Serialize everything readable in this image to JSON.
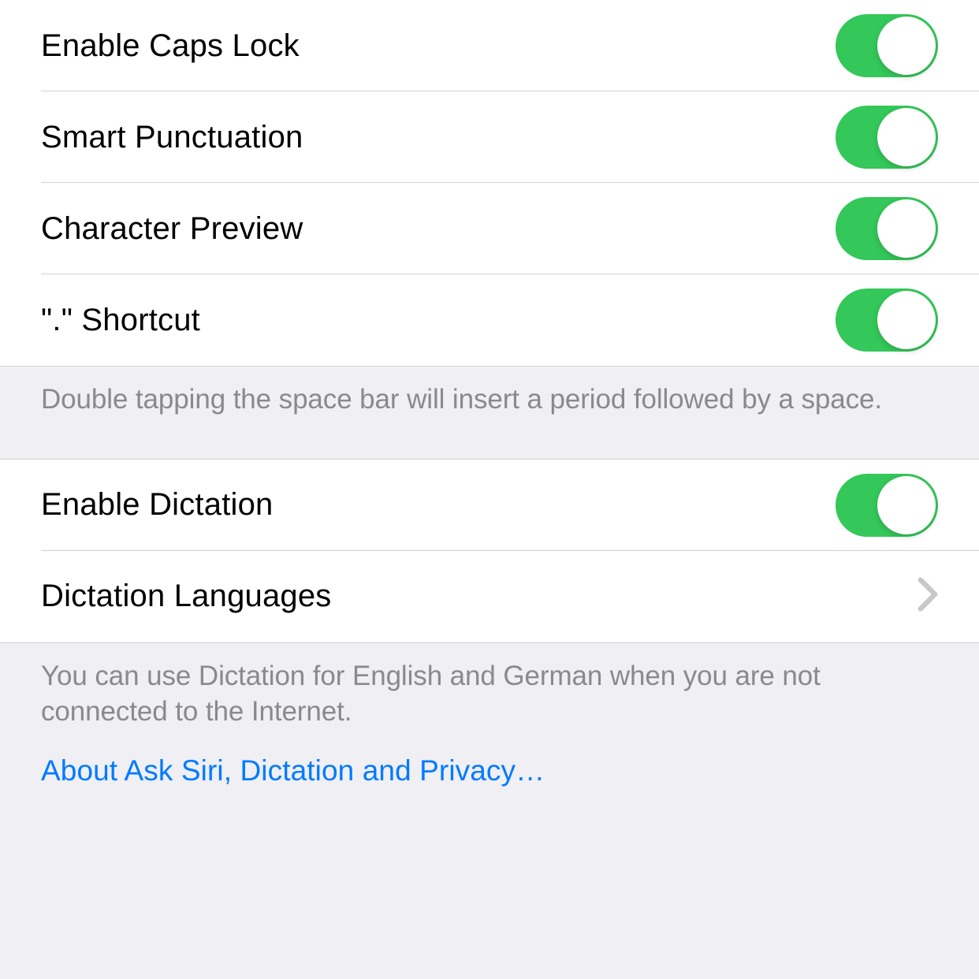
{
  "section1": {
    "items": [
      {
        "label": "Enable Caps Lock",
        "on": true
      },
      {
        "label": "Smart Punctuation",
        "on": true
      },
      {
        "label": "Character Preview",
        "on": true
      },
      {
        "label": "\".\" Shortcut",
        "on": true
      }
    ],
    "footer": "Double tapping the space bar will insert a period followed by a space."
  },
  "section2": {
    "items": [
      {
        "label": "Enable Dictation",
        "type": "toggle",
        "on": true
      },
      {
        "label": "Dictation Languages",
        "type": "nav"
      }
    ],
    "footer": "You can use Dictation for English and German when you are not connected to the Internet.",
    "link": "About Ask Siri, Dictation and Privacy…"
  }
}
